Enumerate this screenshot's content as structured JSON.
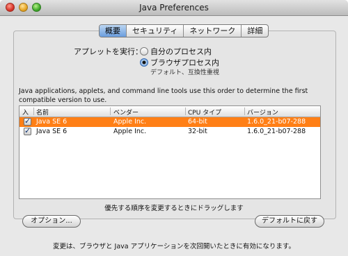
{
  "window": {
    "title": "Java Preferences"
  },
  "tabs": [
    {
      "label": "概要",
      "active": true
    },
    {
      "label": "セキュリティ",
      "active": false
    },
    {
      "label": "ネットワーク",
      "active": false
    },
    {
      "label": "詳細",
      "active": false
    }
  ],
  "applet": {
    "label": "アプレットを実行：",
    "options": [
      {
        "label": "自分のプロセス内",
        "selected": false
      },
      {
        "label": "ブラウザプロセス内",
        "selected": true,
        "sublabel": "デフォルト、互換性重視"
      }
    ]
  },
  "description": "Java applications, applets, and command line tools use this order to determine the first compatible version to use.",
  "table": {
    "columns": [
      "入",
      "名前",
      "ベンダー",
      "CPU タイプ",
      "バージョン"
    ],
    "rows": [
      {
        "checked": true,
        "name": "Java SE 6",
        "vendor": "Apple Inc.",
        "cpu": "64-bit",
        "version": "1.6.0_21-b07-288",
        "selected": true
      },
      {
        "checked": true,
        "name": "Java SE 6",
        "vendor": "Apple Inc.",
        "cpu": "32-bit",
        "version": "1.6.0_21-b07-288",
        "selected": false
      }
    ]
  },
  "hint": "優先する順序を変更するときにドラッグします",
  "buttons": {
    "options": "オプション...",
    "restore_defaults": "デフォルトに戻す"
  },
  "footer": "変更は、ブラウザと Java アプリケーションを次回開いたときに有効になります。",
  "colors": {
    "selection": "#ff7f16",
    "tab_active": "#6a9dde"
  }
}
